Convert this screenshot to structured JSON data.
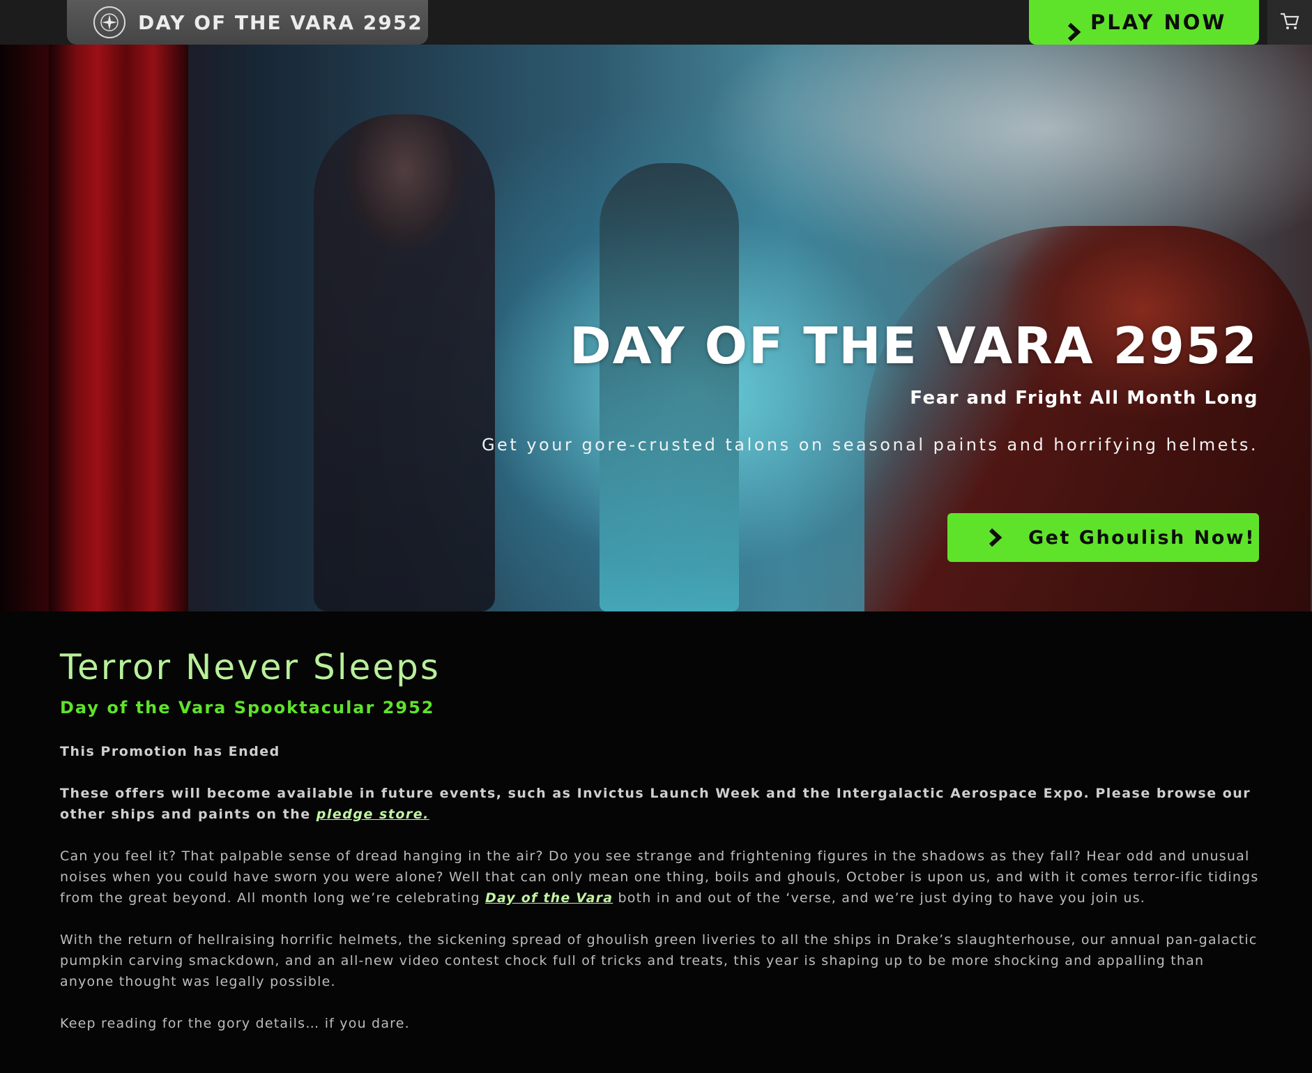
{
  "topbar": {
    "brand_title": "DAY OF THE VARA 2952",
    "logo_icon": "star-citizen-emblem-icon",
    "play_label": "PLAY NOW",
    "cart_icon": "cart-icon"
  },
  "hero": {
    "title": "DAY OF THE VARA 2952",
    "subtitle": "Fear and Fright All Month Long",
    "description": "Get your gore-crusted talons on seasonal paints and horrifying helmets.",
    "cta_label": "Get Ghoulish Now!"
  },
  "content": {
    "title": "Terror Never Sleeps",
    "subtitle": "Day of the Vara Spooktacular 2952",
    "ended_notice": "This Promotion has Ended",
    "offers_text": "These offers will become available in future events, such as Invictus Launch Week and the Intergalactic Aerospace Expo. Please browse our other ships and paints on the ",
    "offers_link": "pledge store.",
    "para1_before": "Can you feel it? That palpable sense of dread hanging in the air? Do you see strange and frightening figures in the shadows as they fall? Hear odd and unusual noises when you could have sworn you were alone? Well that can only mean one thing, boils and ghouls, October is upon us, and with it comes terror-ific tidings from the great beyond. All month long we’re celebrating ",
    "para1_link": "Day of the Vara",
    "para1_after": " both in and out of the ‘verse, and we’re just dying to have you join us.",
    "para2": "With the return of hellraising horrific helmets, the sickening spread of ghoulish green liveries to all the ships in Drake’s slaughterhouse, our annual pan-galactic pumpkin carving smackdown, and an all-new video contest chock full of tricks and treats, this year is shaping up to be more shocking and appalling than anyone thought was legally possible.",
    "para3": "Keep reading for the gory details… if you dare."
  },
  "colors": {
    "accent_green": "#5fe32a",
    "title_green": "#b8f09a",
    "background": "#050505"
  }
}
